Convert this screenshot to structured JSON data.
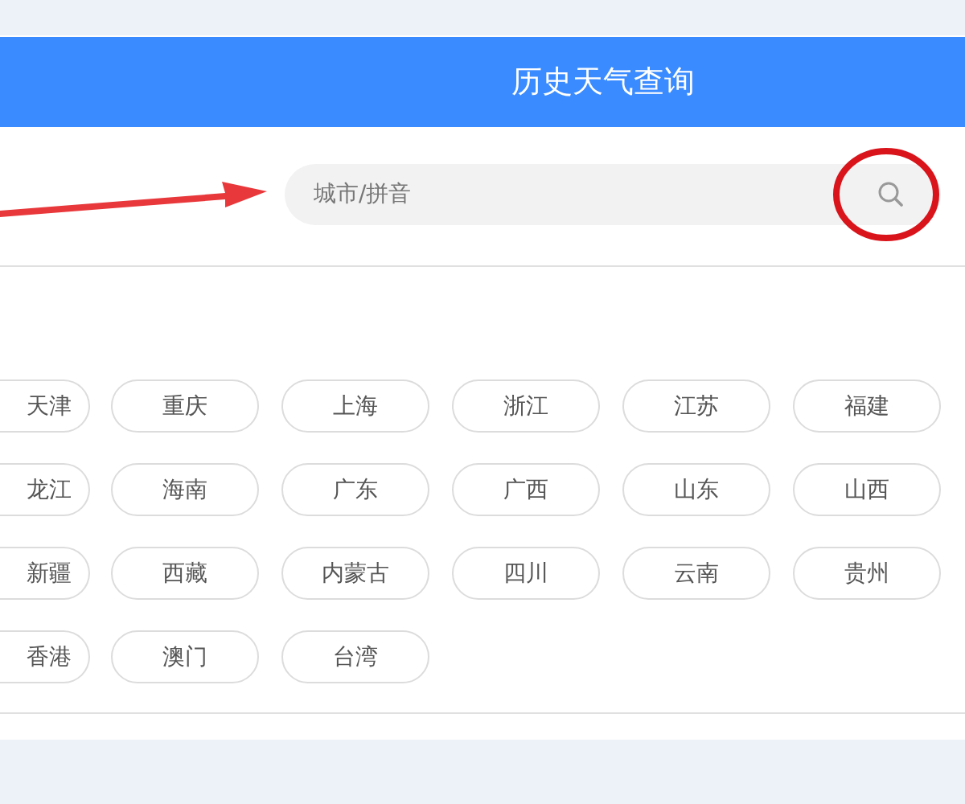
{
  "header": {
    "title": "历史天气查询"
  },
  "search": {
    "placeholder": "城市/拼音"
  },
  "regions": [
    [
      "天津",
      "重庆",
      "上海",
      "浙江",
      "江苏",
      "福建"
    ],
    [
      "龙江",
      "海南",
      "广东",
      "广西",
      "山东",
      "山西"
    ],
    [
      "新疆",
      "西藏",
      "内蒙古",
      "四川",
      "云南",
      "贵州"
    ],
    [
      "香港",
      "澳门",
      "台湾"
    ]
  ]
}
